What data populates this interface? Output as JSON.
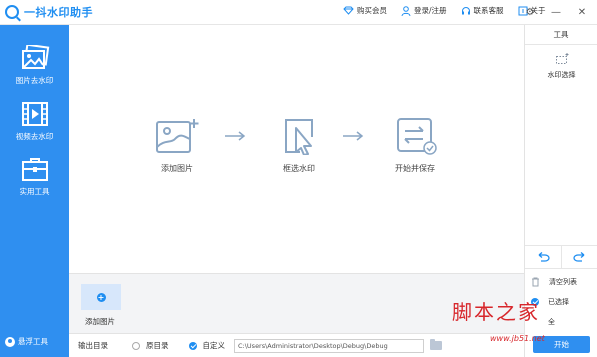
{
  "app": {
    "title": "一抖水印助手"
  },
  "top_links": [
    {
      "label": "购买会员",
      "icon": "diamond-icon"
    },
    {
      "label": "登录/注册",
      "icon": "user-icon"
    },
    {
      "label": "联系客服",
      "icon": "headset-icon"
    },
    {
      "label": "关于",
      "icon": "info-book-icon"
    }
  ],
  "window_controls": {
    "settings": "⚙",
    "minimize": "—",
    "close": "✕"
  },
  "sidebar": {
    "items": [
      {
        "label": "图片去水印",
        "icon": "image-stack-icon"
      },
      {
        "label": "视频去水印",
        "icon": "film-icon"
      },
      {
        "label": "实用工具",
        "icon": "toolbox-icon"
      }
    ],
    "bottom_label": "悬浮工具"
  },
  "steps": [
    {
      "label": "添加图片",
      "icon": "add-image-icon"
    },
    {
      "label": "框选水印",
      "icon": "select-cursor-icon"
    },
    {
      "label": "开始并保存",
      "icon": "swap-save-icon"
    }
  ],
  "strip": {
    "add_label": "添加图片",
    "add_symbol": "+"
  },
  "output": {
    "label": "输出目录",
    "option_original": "原目录",
    "option_custom": "自定义",
    "path": "C:\\Users\\Administrator\\Desktop\\Debug\\Debug"
  },
  "rpanel": {
    "title": "工具",
    "tool_label": "水印选择",
    "clear_label": "清空列表",
    "selected_label": "已选择",
    "all_label": "全",
    "start_label": "开始"
  },
  "overlay": {
    "watermark_text": "脚本之家",
    "watermark_url": "www.jb51.net"
  },
  "colors": {
    "brand": "#2f8ff0",
    "stage_icon": "#8aa6c4",
    "watermark": "#d7262b"
  }
}
